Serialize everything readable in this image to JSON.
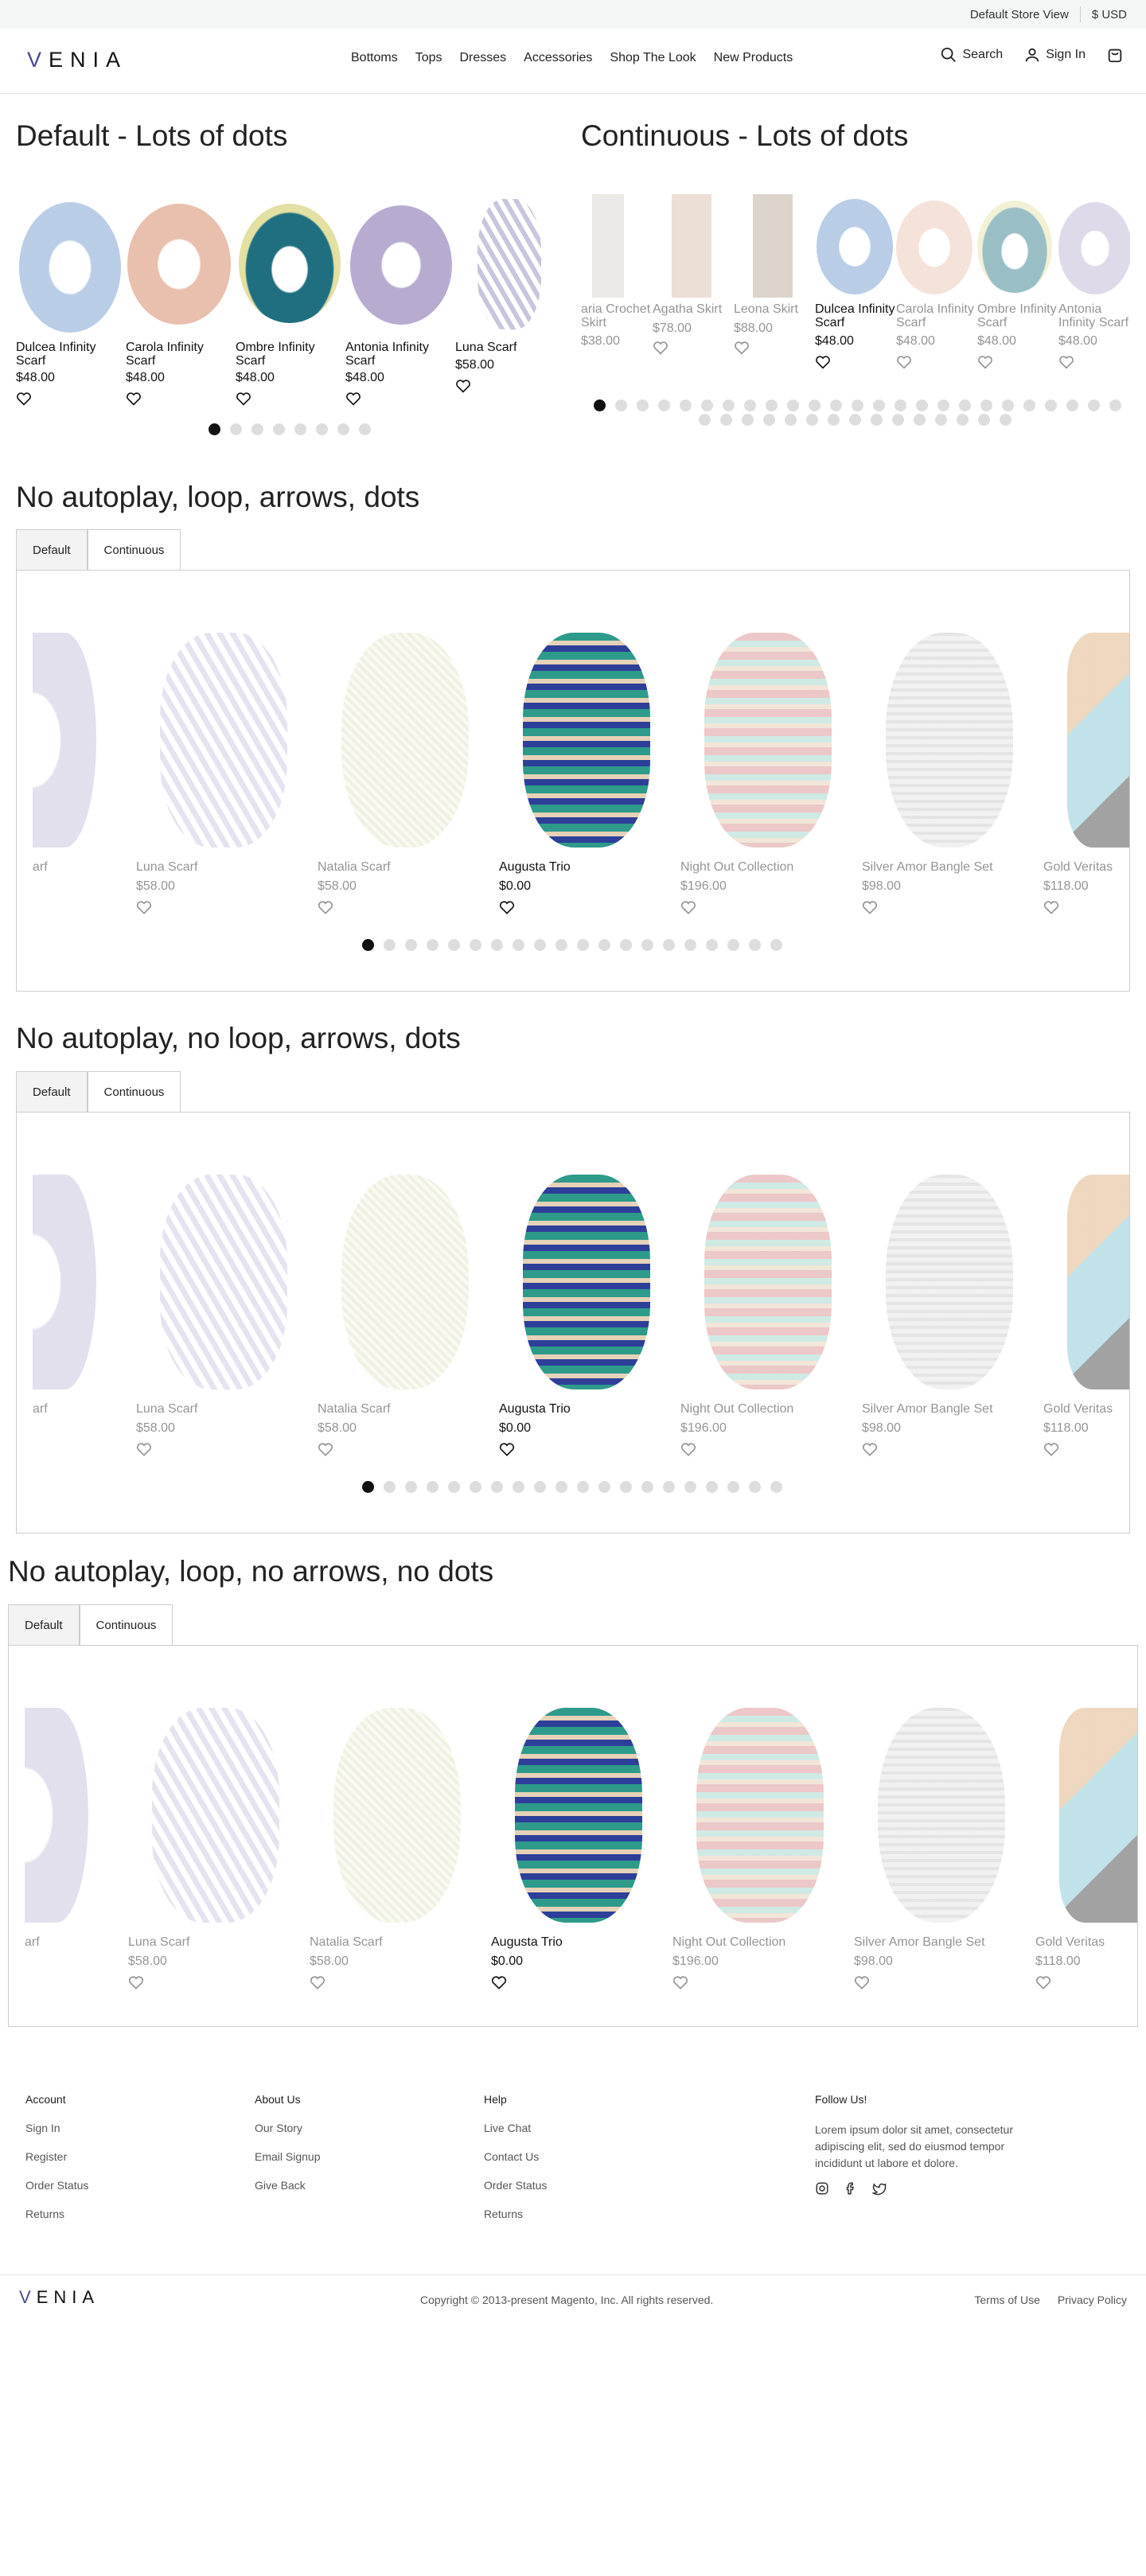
{
  "topbar": {
    "store_view": "Default Store View",
    "currency": "$ USD"
  },
  "header": {
    "logo": "VENIA",
    "nav": [
      "Bottoms",
      "Tops",
      "Dresses",
      "Accessories",
      "Shop The Look",
      "New Products"
    ],
    "search_label": "Search",
    "signin_label": "Sign In"
  },
  "sections": {
    "s1": "Default - Lots of dots",
    "s2": "Continuous - Lots of dots",
    "s3": "No autoplay, loop, arrows, dots",
    "s4": "No autoplay, no loop, arrows, dots",
    "s5": "No autoplay, loop, no arrows, no dots"
  },
  "tabs": {
    "default": "Default",
    "continuous": "Continuous"
  },
  "carousel_a": [
    {
      "name": "Dulcea Infinity Scarf",
      "price": "$48.00",
      "color": "#b9cde6"
    },
    {
      "name": "Carola Infinity Scarf",
      "price": "$48.00",
      "color": "#e8c0ad"
    },
    {
      "name": "Ombre Infinity Scarf",
      "price": "$48.00",
      "color": "#3a8f98"
    },
    {
      "name": "Antonia Infinity Scarf",
      "price": "$48.00",
      "color": "#b7acd0"
    },
    {
      "name": "Luna Scarf",
      "price": "$58.00",
      "color": "#c8c6dc"
    }
  ],
  "carousel_b": [
    {
      "name": "aria Crochet Skirt",
      "price": "$38.00"
    },
    {
      "name": "Agatha Skirt",
      "price": "$78.00"
    },
    {
      "name": "Leona Skirt",
      "price": "$88.00"
    },
    {
      "name": "Dulcea Infinity Scarf",
      "price": "$48.00"
    },
    {
      "name": "Carola Infinity Scarf",
      "price": "$48.00"
    },
    {
      "name": "Ombre Infinity Scarf",
      "price": "$48.00"
    },
    {
      "name": "Antonia Infinity Scarf",
      "price": "$48.00"
    }
  ],
  "carousel_c": [
    {
      "name": "arf",
      "price": ""
    },
    {
      "name": "Luna Scarf",
      "price": "$58.00"
    },
    {
      "name": "Natalia Scarf",
      "price": "$58.00"
    },
    {
      "name": "Augusta Trio",
      "price": "$0.00"
    },
    {
      "name": "Night Out Collection",
      "price": "$196.00"
    },
    {
      "name": "Silver Amor Bangle Set",
      "price": "$98.00"
    },
    {
      "name": "Gold Veritas",
      "price": "$118.00"
    }
  ],
  "footer": {
    "account": {
      "title": "Account",
      "links": [
        "Sign In",
        "Register",
        "Order Status",
        "Returns"
      ]
    },
    "about": {
      "title": "About Us",
      "links": [
        "Our Story",
        "Email Signup",
        "Give Back"
      ]
    },
    "help": {
      "title": "Help",
      "links": [
        "Live Chat",
        "Contact Us",
        "Order Status",
        "Returns"
      ]
    },
    "follow": {
      "title": "Follow Us!",
      "text": "Lorem ipsum dolor sit amet, consectetur adipiscing elit, sed do eiusmod tempor incididunt ut labore et dolore."
    },
    "logo": "VENIA",
    "copyright": "Copyright © 2013-present Magento, Inc. All rights reserved.",
    "terms": "Terms of Use",
    "privacy": "Privacy Policy"
  }
}
